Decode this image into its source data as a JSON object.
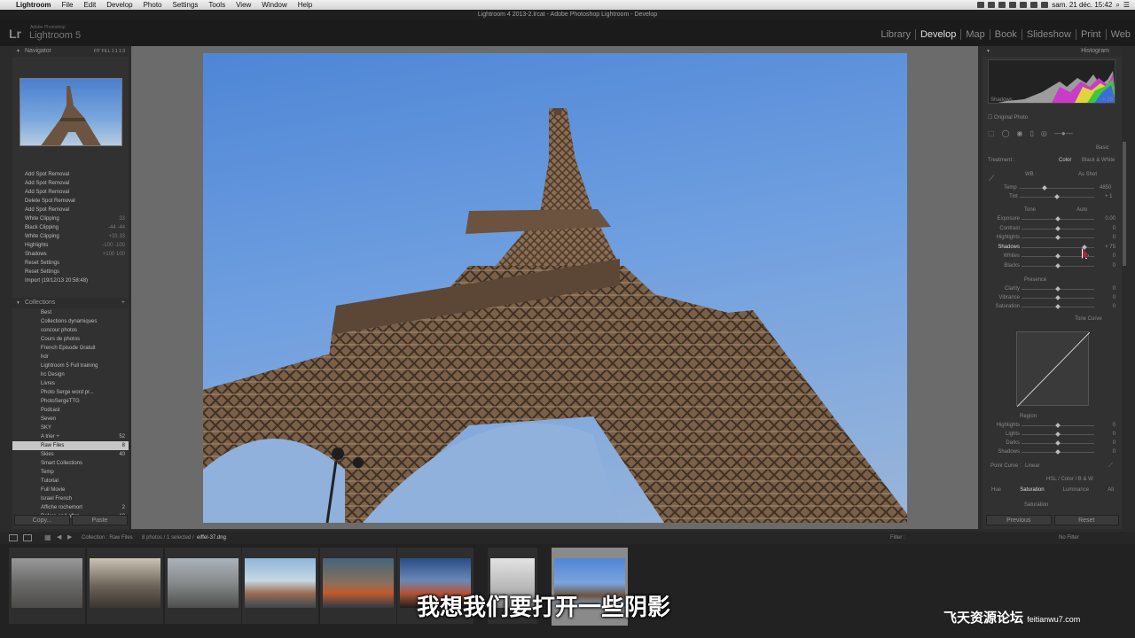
{
  "menubar": {
    "apple": "",
    "items": [
      "Lightroom",
      "File",
      "Edit",
      "Develop",
      "Photo",
      "Settings",
      "Tools",
      "View",
      "Window",
      "Help"
    ],
    "clock": "sam. 21 déc.  15:42"
  },
  "window_title": "Lightroom 4 2013-2.lrcat - Adobe Photoshop Lightroom - Develop",
  "identity": {
    "logo": "Lr",
    "sub": "Adobe Photoshop",
    "name": "Lightroom 5"
  },
  "modules": [
    "Library",
    "Develop",
    "Map",
    "Book",
    "Slideshow",
    "Print",
    "Web"
  ],
  "active_module": "Develop",
  "navigator": {
    "title": "Navigator",
    "zoom": "FIT  FILL  1:1  1:3"
  },
  "history": [
    {
      "label": "Add Spot Removal",
      "a": "",
      "b": ""
    },
    {
      "label": "Add Spot Removal",
      "a": "",
      "b": ""
    },
    {
      "label": "Add Spot Removal",
      "a": "",
      "b": ""
    },
    {
      "label": "Delete Spot Removal",
      "a": "",
      "b": ""
    },
    {
      "label": "Add Spot Removal",
      "a": "",
      "b": ""
    },
    {
      "label": "White Clipping",
      "a": "",
      "b": "33"
    },
    {
      "label": "Black Clipping",
      "a": "-44",
      "b": "-44"
    },
    {
      "label": "White Clipping",
      "a": "+33",
      "b": "33"
    },
    {
      "label": "Highlights",
      "a": "-100",
      "b": "-100"
    },
    {
      "label": "Shadows",
      "a": "+100",
      "b": "100"
    },
    {
      "label": "Reset Settings",
      "a": "",
      "b": ""
    },
    {
      "label": "Reset Settings",
      "a": "",
      "b": ""
    },
    {
      "label": "Import (19/12/13 20:58:48)",
      "a": "",
      "b": ""
    }
  ],
  "collections": {
    "title": "Collections",
    "items": [
      {
        "label": "Best",
        "count": ""
      },
      {
        "label": "Collections dynamiques",
        "count": ""
      },
      {
        "label": "concour photos",
        "count": ""
      },
      {
        "label": "Cours de photos",
        "count": ""
      },
      {
        "label": "French Episode Gratuit",
        "count": ""
      },
      {
        "label": "hdr",
        "count": ""
      },
      {
        "label": "Lightroom 5 Full training",
        "count": ""
      },
      {
        "label": "lrc Design",
        "count": ""
      },
      {
        "label": "Livres",
        "count": ""
      },
      {
        "label": "Photo Serge word pr...",
        "count": ""
      },
      {
        "label": "PhotoSergeTTG",
        "count": ""
      },
      {
        "label": "Podcast",
        "count": ""
      },
      {
        "label": "Seven",
        "count": ""
      },
      {
        "label": "SKY",
        "count": ""
      },
      {
        "label": "A trier +",
        "count": "52"
      },
      {
        "label": "Raw Files",
        "count": "8"
      },
      {
        "label": "Skies",
        "count": "40"
      },
      {
        "label": "Smart Collections",
        "count": ""
      },
      {
        "label": "Temp",
        "count": ""
      },
      {
        "label": "Tutorial",
        "count": ""
      },
      {
        "label": "Full Movie",
        "count": ""
      },
      {
        "label": "Israel French",
        "count": ""
      },
      {
        "label": "Affiche rochemort",
        "count": "2"
      },
      {
        "label": "Before and after",
        "count": "12"
      }
    ]
  },
  "copy_label": "Copy...",
  "paste_label": "Paste",
  "right": {
    "histogram": "Histogram",
    "shadows_label": "Shadows",
    "shadows_val": "+ 29",
    "original_photo": "Original Photo",
    "basic": "Basic",
    "treatment": "Treatment :",
    "color": "Color",
    "bw": "Black & White",
    "wb": "WB :",
    "as_shot": "As Shot",
    "temp": "Temp",
    "temp_val": "4850",
    "tint": "Tint",
    "tint_val": "+ 1",
    "tone": "Tone",
    "auto": "Auto",
    "sliders": [
      {
        "label": "Exposure",
        "val": "0.00",
        "pos": 0.5
      },
      {
        "label": "Contrast",
        "val": "0",
        "pos": 0.5
      },
      {
        "label": "Highlights",
        "val": "0",
        "pos": 0.5
      },
      {
        "label": "Shadows",
        "val": "+ 75",
        "pos": 0.86
      },
      {
        "label": "Whites",
        "val": "0",
        "pos": 0.5
      },
      {
        "label": "Blacks",
        "val": "0",
        "pos": 0.5
      }
    ],
    "presence": "Presence",
    "presence_sliders": [
      {
        "label": "Clarity",
        "val": "0",
        "pos": 0.5
      },
      {
        "label": "Vibrance",
        "val": "0",
        "pos": 0.5
      },
      {
        "label": "Saturation",
        "val": "0",
        "pos": 0.5
      }
    ],
    "tone_curve": "Tone Curve",
    "region": "Region",
    "region_sliders": [
      {
        "label": "Highlights",
        "val": "0",
        "pos": 0.5
      },
      {
        "label": "Lights",
        "val": "0",
        "pos": 0.5
      },
      {
        "label": "Darks",
        "val": "0",
        "pos": 0.5
      },
      {
        "label": "Shadows",
        "val": "0",
        "pos": 0.5
      }
    ],
    "point_curve": "Point Curve :",
    "point_curve_val": "Linear",
    "hsl": "HSL  /  Color  /  B & W",
    "hsl_tabs": [
      "Hue",
      "Saturation",
      "Luminance",
      "All"
    ],
    "saturation": "Saturation",
    "previous": "Previous",
    "reset": "Reset"
  },
  "filmstrip_bar": {
    "path": "Collection : Raw Files",
    "info": "8 photos / 1 selected /",
    "file": "eiffel-37.dng",
    "filter_label": "Filter :",
    "filter_val": "No Filter"
  },
  "subtitle": "我想我们要打开一些阴影",
  "watermark": {
    "cn": "飞天资源论坛",
    "url": "feitianwu7.com"
  }
}
